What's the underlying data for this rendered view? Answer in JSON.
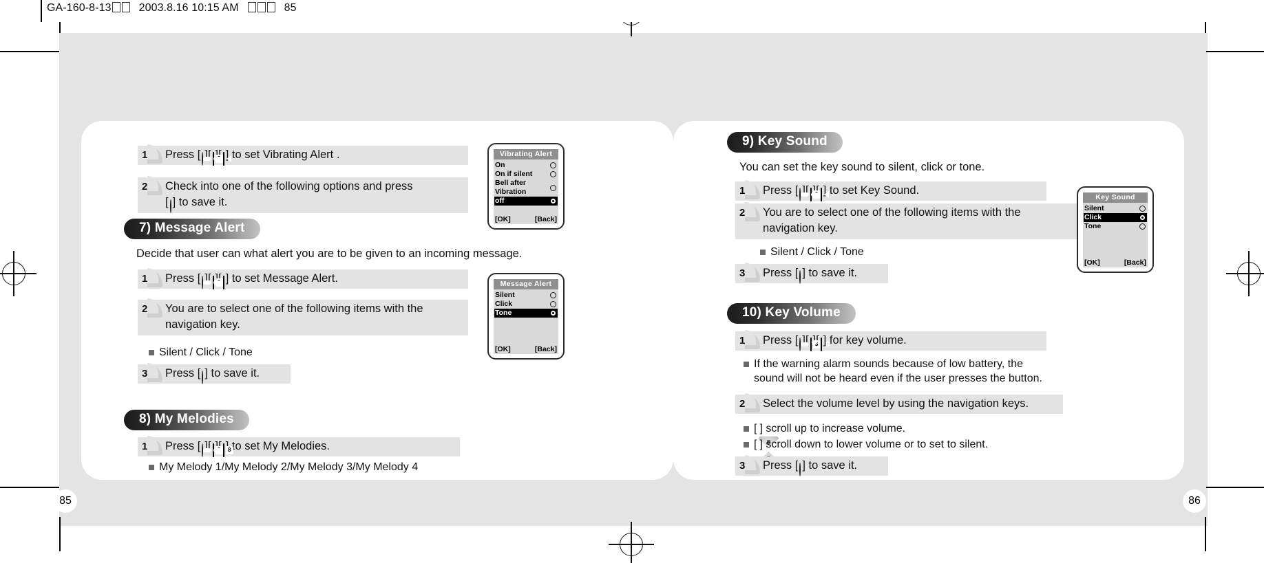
{
  "proof": {
    "job_code": "GA-160-8-13",
    "timestamp": "2003.8.16 10:15 AM",
    "page_marker": "85"
  },
  "pages": {
    "left_number": "85",
    "right_number": "86"
  },
  "left_page": {
    "vibrating_alert": {
      "steps": [
        {
          "num": "1",
          "lines": [
            {
              "parts": [
                {
                  "t": "text",
                  "v": "Press ["
                },
                {
                  "t": "icon",
                  "v": "ok-key-icon"
                },
                {
                  "t": "text",
                  "v": "]["
                },
                {
                  "t": "icon",
                  "v": "menu-key-icon"
                },
                {
                  "t": "text",
                  "v": "]["
                },
                {
                  "t": "icon",
                  "v": "left-soft-key-icon"
                },
                {
                  "t": "text",
                  "v": "] to set Vibrating Alert ."
                }
              ]
            }
          ]
        },
        {
          "num": "2",
          "lines": [
            {
              "parts": [
                {
                  "t": "text",
                  "v": "Check into one of the following options and press"
                }
              ]
            },
            {
              "parts": [
                {
                  "t": "text",
                  "v": "["
                },
                {
                  "t": "icon",
                  "v": "ok-key-icon"
                },
                {
                  "t": "text",
                  "v": "] to save it."
                }
              ]
            }
          ]
        }
      ],
      "screen": {
        "title": "Vibrating Alert",
        "options": [
          {
            "label": "On",
            "selected": false
          },
          {
            "label": "On if silent",
            "selected": false
          },
          {
            "label": "Bell after Vibration",
            "selected": false
          },
          {
            "label": "off",
            "selected": true
          }
        ],
        "left_soft": "[OK]",
        "right_soft": "[Back]"
      }
    },
    "message_alert": {
      "heading": "7) Message Alert",
      "intro": "Decide that user can what alert you are to be given to an incoming message.",
      "steps": [
        {
          "num": "1",
          "lines": [
            {
              "parts": [
                {
                  "t": "text",
                  "v": "Press ["
                },
                {
                  "t": "icon",
                  "v": "ok-key-icon"
                },
                {
                  "t": "text",
                  "v": "]["
                },
                {
                  "t": "icon",
                  "v": "menu-key-icon"
                },
                {
                  "t": "text",
                  "v": "]["
                },
                {
                  "t": "icon",
                  "v": "seven-key-icon"
                },
                {
                  "t": "text",
                  "v": "] to set Message Alert."
                }
              ]
            }
          ]
        },
        {
          "num": "2",
          "lines": [
            {
              "parts": [
                {
                  "t": "text",
                  "v": "You are to select one of the following items with the"
                }
              ]
            },
            {
              "parts": [
                {
                  "t": "text",
                  "v": "navigation key."
                }
              ]
            }
          ]
        }
      ],
      "bullet": "Silent / Click / Tone",
      "step3": {
        "num": "3",
        "lines": [
          {
            "parts": [
              {
                "t": "text",
                "v": "Press ["
              },
              {
                "t": "icon",
                "v": "ok-key-icon"
              },
              {
                "t": "text",
                "v": "] to save it."
              }
            ]
          }
        ]
      },
      "screen": {
        "title": "Message Alert",
        "options": [
          {
            "label": "Silent",
            "selected": false
          },
          {
            "label": "Click",
            "selected": false
          },
          {
            "label": "Tone",
            "selected": true
          }
        ],
        "left_soft": "[OK]",
        "right_soft": "[Back]"
      }
    },
    "my_melodies": {
      "heading": "8) My Melodies",
      "steps": [
        {
          "num": "1",
          "lines": [
            {
              "parts": [
                {
                  "t": "text",
                  "v": "Press ["
                },
                {
                  "t": "icon",
                  "v": "ok-key-icon"
                },
                {
                  "t": "text",
                  "v": "]["
                },
                {
                  "t": "icon",
                  "v": "menu-key-icon"
                },
                {
                  "t": "text",
                  "v": "]["
                },
                {
                  "t": "icon",
                  "v": "eight-key-icon"
                },
                {
                  "t": "text",
                  "v": "] to set My Melodies."
                }
              ]
            }
          ]
        }
      ],
      "bullet": "My Melody 1/My Melody 2/My Melody 3/My Melody 4"
    }
  },
  "right_page": {
    "key_sound": {
      "heading": "9) Key Sound",
      "intro": "You can set the key sound to silent, click or tone.",
      "steps": [
        {
          "num": "1",
          "lines": [
            {
              "parts": [
                {
                  "t": "text",
                  "v": "Press ["
                },
                {
                  "t": "icon",
                  "v": "ok-key-icon"
                },
                {
                  "t": "text",
                  "v": "]["
                },
                {
                  "t": "icon",
                  "v": "menu-key-icon"
                },
                {
                  "t": "text",
                  "v": "]["
                },
                {
                  "t": "icon",
                  "v": "left-soft-key-icon"
                },
                {
                  "t": "text",
                  "v": "] to set Key Sound."
                }
              ]
            }
          ]
        },
        {
          "num": "2",
          "lines": [
            {
              "parts": [
                {
                  "t": "text",
                  "v": "You are to select one of the following items with the"
                }
              ]
            },
            {
              "parts": [
                {
                  "t": "text",
                  "v": "navigation key."
                }
              ]
            }
          ]
        }
      ],
      "bullet": "Silent / Click / Tone",
      "step3": {
        "num": "3",
        "lines": [
          {
            "parts": [
              {
                "t": "text",
                "v": "Press ["
              },
              {
                "t": "icon",
                "v": "ok-key-icon"
              },
              {
                "t": "text",
                "v": "] to save it."
              }
            ]
          }
        ]
      },
      "screen": {
        "title": "Key Sound",
        "options": [
          {
            "label": "Silent",
            "selected": false
          },
          {
            "label": "Click",
            "selected": true
          },
          {
            "label": "Tone",
            "selected": false
          }
        ],
        "left_soft": "[OK]",
        "right_soft": "[Back]"
      }
    },
    "key_volume": {
      "heading": "10) Key Volume",
      "steps": [
        {
          "num": "1",
          "lines": [
            {
              "parts": [
                {
                  "t": "text",
                  "v": "Press ["
                },
                {
                  "t": "icon",
                  "v": "ok-key-icon"
                },
                {
                  "t": "text",
                  "v": "]["
                },
                {
                  "t": "icon",
                  "v": "menu-key-icon"
                },
                {
                  "t": "text",
                  "v": "]["
                },
                {
                  "t": "icon",
                  "v": "zero-key-icon"
                },
                {
                  "t": "text",
                  "v": "] for key volume."
                }
              ]
            }
          ]
        }
      ],
      "note_lines": [
        "If the warning alarm sounds because of low battery, the",
        "sound will not be heard even if the user presses the button."
      ],
      "step2": {
        "num": "2",
        "lines": [
          {
            "parts": [
              {
                "t": "text",
                "v": "Select the volume level by using the navigation keys."
              }
            ]
          }
        ]
      },
      "nav_bullets": [
        {
          "icon": "nav-up-icon",
          "prefix": "[",
          "suffix": "] scroll up to increase volume."
        },
        {
          "icon": "nav-down-icon",
          "prefix": "[",
          "suffix": "] scroll down to lower volume or to set to silent."
        }
      ],
      "step3": {
        "num": "3",
        "lines": [
          {
            "parts": [
              {
                "t": "text",
                "v": "Press ["
              },
              {
                "t": "icon",
                "v": "ok-key-icon"
              },
              {
                "t": "text",
                "v": "] to save it."
              }
            ]
          }
        ]
      }
    }
  },
  "colors": {
    "bleed_gray": "#e4e4e4",
    "step_gray": "#e3e3e3",
    "pill_dark": "#1b1b1b",
    "pill_light": "#c2c2c2",
    "phone_screen": "#d9d9d9",
    "phone_title_bar": "#8f8f8f"
  }
}
